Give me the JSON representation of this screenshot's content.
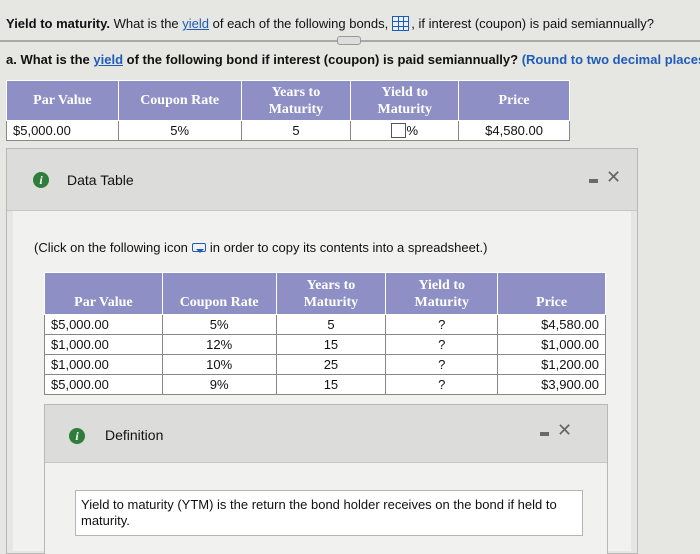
{
  "question": {
    "lead_bold": "Yield to maturity.",
    "text_pre": " What is the ",
    "link": "yield",
    "text_mid": " of each of the following bonds,",
    "text_post": ", if interest (coupon) is paid semiannually?"
  },
  "part_a": {
    "pre": "a. What is the ",
    "link": "yield",
    "post": " of the following bond if interest (coupon) is paid semiannually? ",
    "hint": "(Round to two decimal places.)"
  },
  "bond_table": {
    "headers": {
      "par": "Par Value",
      "coupon": "Coupon Rate",
      "years_1": "Years to",
      "years_2": "Maturity",
      "ytm_1": "Yield to",
      "ytm_2": "Maturity",
      "price": "Price"
    },
    "row": {
      "par": "$5,000.00",
      "coupon": "5%",
      "years": "5",
      "unit": "%",
      "price": "$4,580.00"
    }
  },
  "data_table_dialog": {
    "title": "Data Table",
    "note_pre": "(Click on the following icon",
    "note_post": "in order to copy its contents into a spreadsheet.)",
    "headers": {
      "par": "Par Value",
      "coupon": "Coupon Rate",
      "years_1": "Years to",
      "years_2": "Maturity",
      "ytm_1": "Yield to",
      "ytm_2": "Maturity",
      "price": "Price"
    },
    "rows": [
      {
        "par": "$5,000.00",
        "coupon": "5%",
        "years": "5",
        "ytm": "?",
        "price": "$4,580.00"
      },
      {
        "par": "$1,000.00",
        "coupon": "12%",
        "years": "15",
        "ytm": "?",
        "price": "$1,000.00"
      },
      {
        "par": "$1,000.00",
        "coupon": "10%",
        "years": "25",
        "ytm": "?",
        "price": "$1,200.00"
      },
      {
        "par": "$5,000.00",
        "coupon": "9%",
        "years": "15",
        "ytm": "?",
        "price": "$3,900.00"
      }
    ]
  },
  "definition_dialog": {
    "title": "Definition",
    "text": "Yield to maturity (YTM) is the return the bond holder receives on the bond if held to maturity."
  },
  "icons": {
    "info": "i",
    "close": "✕"
  },
  "colors": {
    "header": "#8e8fc4",
    "link": "#1f5bb8",
    "info": "#2f7d3a"
  }
}
